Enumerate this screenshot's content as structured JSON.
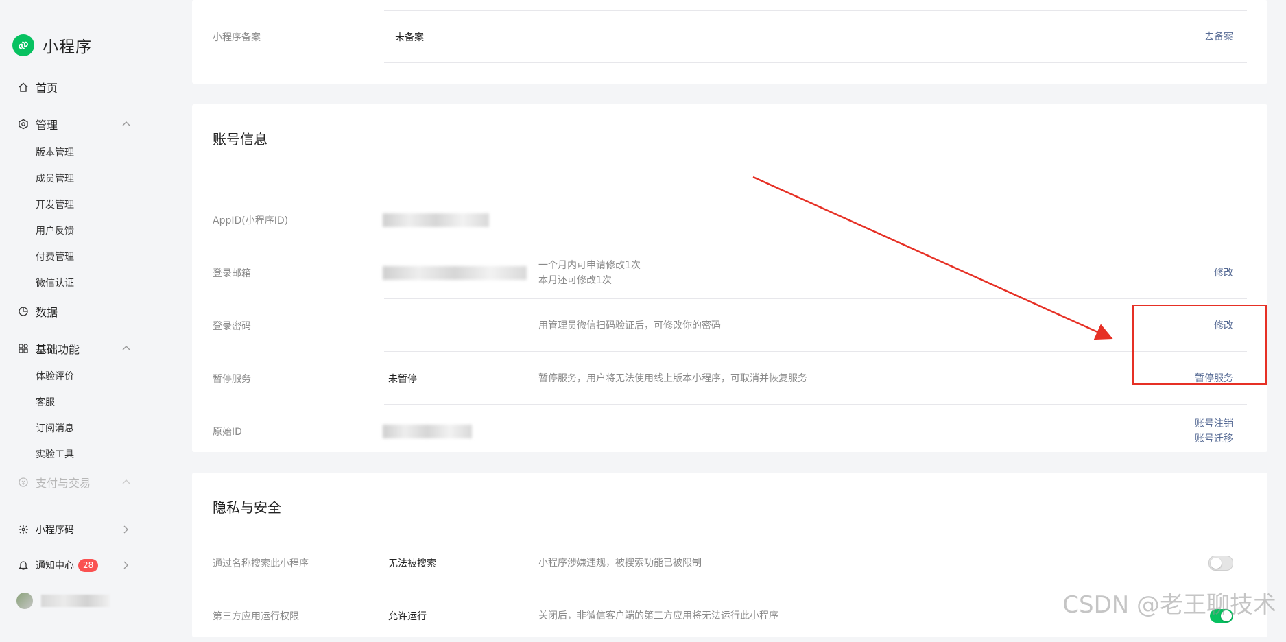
{
  "brand": {
    "name": "小程序"
  },
  "nav": {
    "home": "首页",
    "manage": "管理",
    "manage_items": [
      "版本管理",
      "成员管理",
      "开发管理",
      "用户反馈",
      "付费管理",
      "微信认证"
    ],
    "data": "数据",
    "basic": "基础功能",
    "basic_items": [
      "体验评价",
      "客服",
      "订阅消息",
      "实验工具"
    ],
    "pay": "支付与交易",
    "qrcode": "小程序码",
    "notify": "通知中心",
    "notify_count": "28"
  },
  "record_card": {
    "label": "小程序备案",
    "value": "未备案",
    "action": "去备案"
  },
  "account_card": {
    "title": "账号信息",
    "rows": [
      {
        "label": "AppID(小程序ID)"
      },
      {
        "label": "登录邮箱",
        "desc_1": "一个月内可申请修改1次",
        "desc_2": "本月还可修改1次",
        "action": "修改"
      },
      {
        "label": "登录密码",
        "desc": "用管理员微信扫码验证后，可修改你的密码",
        "action": "修改"
      },
      {
        "label": "暂停服务",
        "value": "未暂停",
        "desc": "暂停服务，用户将无法使用线上版本小程序，可取消并恢复服务",
        "action": "暂停服务"
      },
      {
        "label": "原始ID",
        "action_1": "账号注销",
        "action_2": "账号迁移"
      }
    ]
  },
  "privacy_card": {
    "title": "隐私与安全",
    "rows": [
      {
        "label": "通过名称搜索此小程序",
        "value": "无法被搜索",
        "desc": "小程序涉嫌违规，被搜索功能已被限制",
        "toggle": "off"
      },
      {
        "label": "第三方应用运行权限",
        "value": "允许运行",
        "desc": "关闭后，非微信客户端的第三方应用将无法运行此小程序",
        "toggle": "on"
      }
    ]
  },
  "colors": {
    "accent": "#07c160",
    "link": "#576b95",
    "annotation": "#e63025",
    "badge": "#fa5151"
  },
  "watermark": "CSDN @老王聊技术"
}
